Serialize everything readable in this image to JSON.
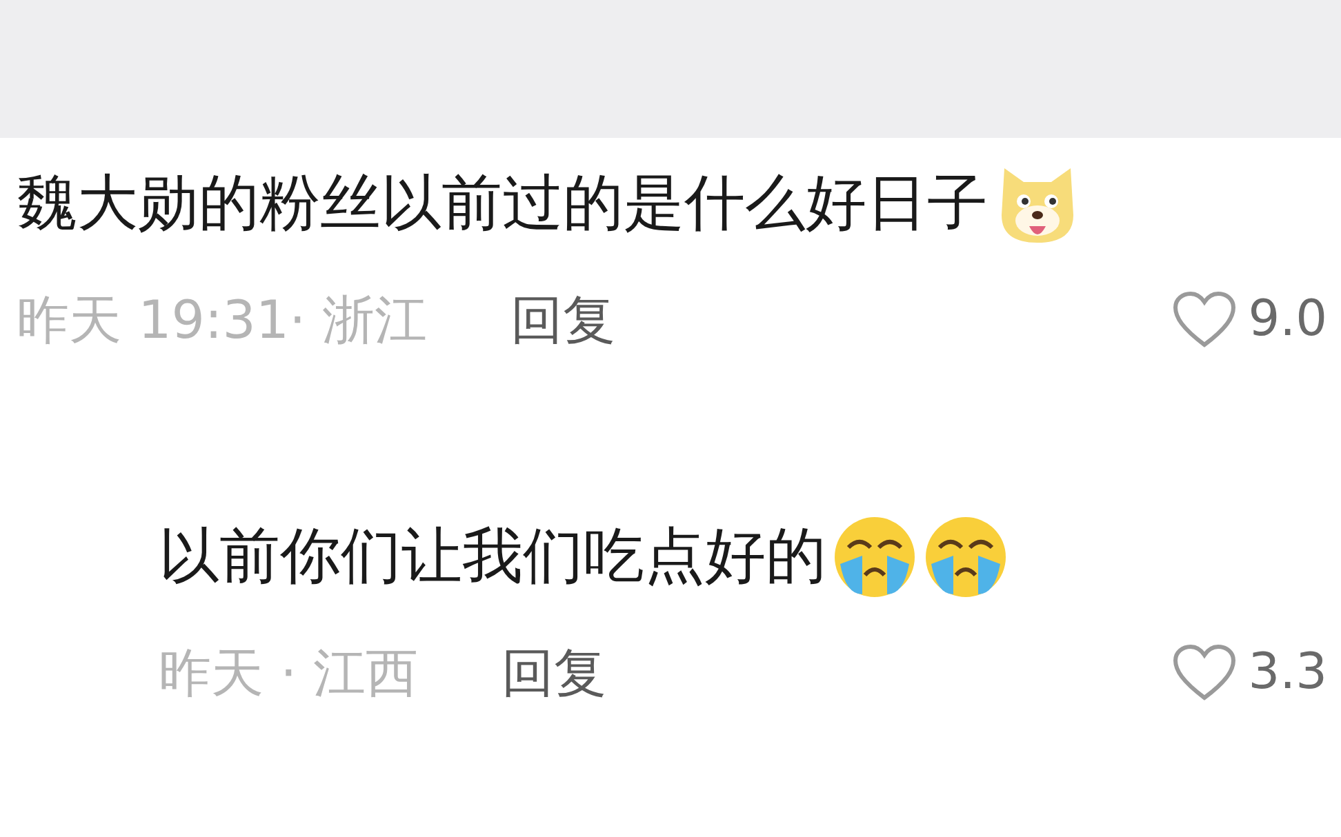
{
  "comments": [
    {
      "text": "魏大勋的粉丝以前过的是什么好日子",
      "emojis": [
        {
          "kind": "dog"
        }
      ],
      "meta": "昨天 19:31· 浙江",
      "reply": "回复",
      "likes": "9.0",
      "children": [
        {
          "text": "以前你们让我们吃点好的",
          "emojis": [
            {
              "kind": "crying"
            },
            {
              "kind": "crying"
            }
          ],
          "meta": "昨天 · 江西",
          "reply": "回复",
          "likes": "3.3"
        }
      ]
    }
  ]
}
